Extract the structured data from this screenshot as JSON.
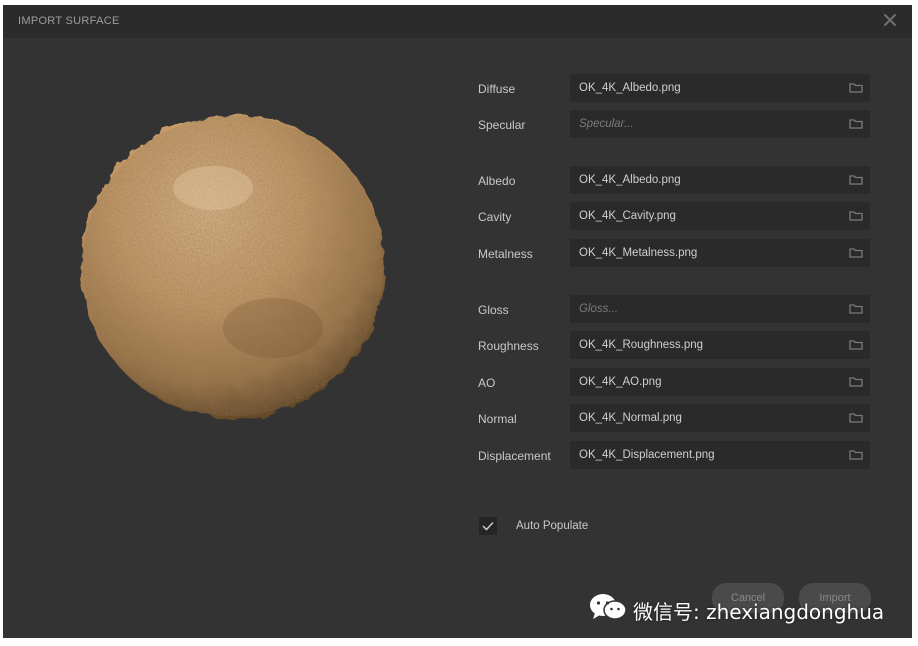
{
  "dialog": {
    "title": "IMPORT SURFACE",
    "close_icon": "close-icon"
  },
  "preview": {
    "label": "material sphere preview"
  },
  "fields": [
    {
      "id": "diffuse",
      "label": "Diffuse",
      "value": "OK_4K_Albedo.png",
      "placeholder": false
    },
    {
      "id": "specular",
      "label": "Specular",
      "value": "Specular...",
      "placeholder": true
    },
    {
      "id": "albedo",
      "label": "Albedo",
      "value": "OK_4K_Albedo.png",
      "placeholder": false
    },
    {
      "id": "cavity",
      "label": "Cavity",
      "value": "OK_4K_Cavity.png",
      "placeholder": false
    },
    {
      "id": "metalness",
      "label": "Metalness",
      "value": "OK_4K_Metalness.png",
      "placeholder": false
    },
    {
      "id": "gloss",
      "label": "Gloss",
      "value": "Gloss...",
      "placeholder": true
    },
    {
      "id": "roughness",
      "label": "Roughness",
      "value": "OK_4K_Roughness.png",
      "placeholder": false
    },
    {
      "id": "ao",
      "label": "AO",
      "value": "OK_4K_AO.png",
      "placeholder": false
    },
    {
      "id": "normal",
      "label": "Normal",
      "value": "OK_4K_Normal.png",
      "placeholder": false
    },
    {
      "id": "displacement",
      "label": "Displacement",
      "value": "OK_4K_Displacement.png",
      "placeholder": false
    }
  ],
  "auto_populate": {
    "label": "Auto Populate",
    "checked": true
  },
  "buttons": {
    "cancel": "Cancel",
    "import": "Import"
  },
  "watermark": {
    "text": "微信号: zhexiangdonghua"
  },
  "colors": {
    "background": "#333334",
    "field": "#2a2a2b",
    "text": "#c9c9c9"
  }
}
